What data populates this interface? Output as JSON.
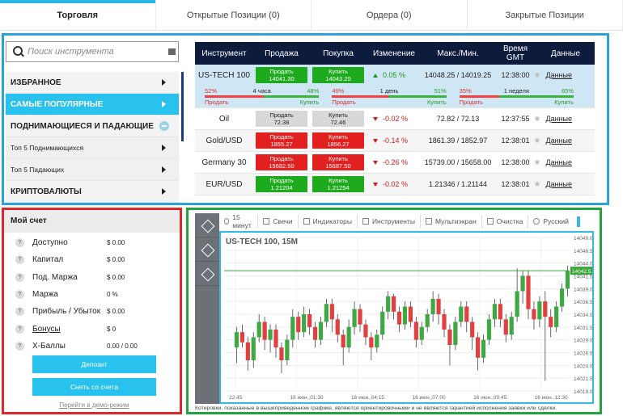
{
  "tabs": [
    {
      "label": "Торговля",
      "active": true
    },
    {
      "label": "Открытые Позиции (0)",
      "active": false
    },
    {
      "label": "Ордера (0)",
      "active": false
    },
    {
      "label": "Закрытые Позиции",
      "active": false
    }
  ],
  "search": {
    "placeholder": "Поиск инструмента"
  },
  "categories": [
    {
      "label": "ИЗБРАННОЕ"
    },
    {
      "label": "САМЫЕ ПОПУЛЯРНЫЕ"
    },
    {
      "label": "ПОДНИМАЮЩИЕСЯ И ПАДАЮЩИЕ"
    },
    {
      "label": "Топ 5 Поднимающихся"
    },
    {
      "label": "Топ 5 Падающих"
    },
    {
      "label": "КРИПТОВАЛЮТЫ"
    }
  ],
  "table": {
    "headers": {
      "instrument": "Инструмент",
      "sell": "Продажа",
      "buy": "Покупка",
      "change": "Изменение",
      "maxmin": "Макс./Мин.",
      "time": "Время GMT",
      "data": "Данные"
    },
    "sell_word": "Продать",
    "buy_word": "Купить",
    "data_link": "Данные",
    "rows": [
      {
        "name": "US-TECH 100",
        "sell": "14041.30",
        "buy": "14043.20",
        "change": "0.05 %",
        "maxmin": "14048.25 / 14019.25",
        "time": "12:38:00"
      },
      {
        "name": "Oil",
        "sell": "72.38",
        "buy": "72.46",
        "change": "-0.02 %",
        "maxmin": "72.82 / 72.13",
        "time": "12:37:55"
      },
      {
        "name": "Gold/USD",
        "sell": "1855.27",
        "buy": "1856.27",
        "change": "-0.14 %",
        "maxmin": "1861.39 / 1852.97",
        "time": "12:38:01"
      },
      {
        "name": "Germany 30",
        "sell": "15682.50",
        "buy": "15687.50",
        "change": "-0.26 %",
        "maxmin": "15739.00 / 15658.00",
        "time": "12:38:00"
      },
      {
        "name": "EUR/USD",
        "sell": "1.21204",
        "buy": "1.21254",
        "change": "-0.02 %",
        "maxmin": "1.21346 / 1.21144",
        "time": "12:38:01"
      }
    ],
    "sentiment": [
      {
        "left_pct": "52%",
        "period": "4 часа",
        "right_pct": "48%",
        "value": 0.52
      },
      {
        "left_pct": "49%",
        "period": "1 день",
        "right_pct": "51%",
        "value": 0.49
      },
      {
        "left_pct": "35%",
        "period": "1 неделя",
        "right_pct": "65%",
        "value": 0.35
      }
    ]
  },
  "account": {
    "title": "Мой счет",
    "rows": [
      {
        "label": "Доступно",
        "value": "$ 0.00"
      },
      {
        "label": "Капитал",
        "value": "$ 0.00"
      },
      {
        "label": "Под. Маржа",
        "value": "$ 0.00"
      },
      {
        "label": "Маржа",
        "value": "0 %"
      },
      {
        "label": "Прибыль / Убыток",
        "value": "$ 0.00"
      },
      {
        "label": "Бонусы",
        "value": "$ 0"
      },
      {
        "label": "Х-Баллы",
        "value": "0.00 / 0.00"
      }
    ],
    "deposit_label": "Депозит",
    "withdraw_label": "Снять со счета",
    "demo_label": "Перейти в демо-режим"
  },
  "chart_toolbar": [
    "15 минут",
    "Свечи",
    "Индикаторы",
    "Инструменты",
    "Мультиэкран",
    "Очистка",
    "Русский"
  ],
  "chart_data": {
    "type": "candlestick",
    "title": "US-TECH 100, 15M",
    "current_price": "14042.5",
    "y_ticks": [
      "14049.0",
      "14046.5",
      "14044.0",
      "14041.5",
      "14039.0",
      "14036.5",
      "14034.0",
      "14031.5",
      "14029.0",
      "14026.5",
      "14024.0",
      "14021.5",
      "14019.0"
    ],
    "x_ticks": [
      "22:45",
      "16 июн.,01:30",
      "16 июн.,04:15",
      "16 июн.,07:00",
      "16 июн.,09:45",
      "16 июн.,12:30"
    ],
    "ylim": [
      14019,
      14049
    ],
    "candles": [
      [
        14027.5,
        14030.5,
        14024.5,
        14031.5
      ],
      [
        14030.5,
        14028.5,
        14027.5,
        14032.0
      ],
      [
        14028.5,
        14025.0,
        14023.0,
        14029.5
      ],
      [
        14025.0,
        14029.5,
        14023.5,
        14030.5
      ],
      [
        14029.5,
        14032.5,
        14028.5,
        14034.0
      ],
      [
        14032.5,
        14029.0,
        14027.0,
        14033.5
      ],
      [
        14029.0,
        14031.0,
        14026.5,
        14032.0
      ],
      [
        14031.0,
        14027.5,
        14025.5,
        14032.0
      ],
      [
        14027.5,
        14025.0,
        14022.5,
        14028.5
      ],
      [
        14025.0,
        14029.0,
        14024.0,
        14030.0
      ],
      [
        14029.0,
        14033.5,
        14027.5,
        14035.0
      ],
      [
        14033.5,
        14030.5,
        14029.0,
        14034.5
      ],
      [
        14030.5,
        14034.0,
        14029.5,
        14035.5
      ],
      [
        14034.0,
        14031.5,
        14030.0,
        14035.0
      ],
      [
        14031.5,
        14029.0,
        14027.5,
        14032.5
      ],
      [
        14029.0,
        14032.5,
        14028.0,
        14033.5
      ],
      [
        14032.5,
        14036.0,
        14031.5,
        14037.0
      ],
      [
        14036.0,
        14033.0,
        14030.5,
        14037.0
      ],
      [
        14033.0,
        14030.0,
        14028.5,
        14034.0
      ],
      [
        14030.0,
        14027.5,
        14024.0,
        14031.0
      ],
      [
        14027.5,
        14031.5,
        14026.5,
        14033.0
      ],
      [
        14031.5,
        14035.0,
        14030.0,
        14036.5
      ],
      [
        14035.0,
        14032.0,
        14030.5,
        14036.0
      ],
      [
        14032.0,
        14029.5,
        14028.0,
        14033.0
      ],
      [
        14029.5,
        14027.5,
        14025.0,
        14030.5
      ],
      [
        14027.5,
        14030.0,
        14026.5,
        14031.0
      ],
      [
        14030.0,
        14034.5,
        14029.0,
        14035.5
      ],
      [
        14034.5,
        14037.5,
        14033.0,
        14038.5
      ],
      [
        14037.5,
        14034.5,
        14033.0,
        14038.0
      ],
      [
        14034.5,
        14032.0,
        14030.5,
        14035.5
      ],
      [
        14032.0,
        14035.5,
        14031.0,
        14036.5
      ],
      [
        14035.5,
        14032.5,
        14031.5,
        14036.5
      ],
      [
        14032.5,
        14029.0,
        14027.5,
        14033.5
      ],
      [
        14029.0,
        14031.5,
        14028.0,
        14032.5
      ],
      [
        14031.5,
        14034.0,
        14030.5,
        14035.0
      ],
      [
        14034.0,
        14037.0,
        14032.5,
        14038.5
      ],
      [
        14037.0,
        14034.0,
        14032.0,
        14038.0
      ],
      [
        14034.0,
        14031.0,
        14029.5,
        14035.0
      ],
      [
        14031.0,
        14028.0,
        14024.0,
        14032.0
      ],
      [
        14028.0,
        14032.5,
        14027.0,
        14033.5
      ],
      [
        14032.5,
        14035.5,
        14031.5,
        14036.5
      ],
      [
        14035.5,
        14032.5,
        14030.5,
        14036.5
      ],
      [
        14032.5,
        14029.5,
        14027.0,
        14033.5
      ],
      [
        14029.5,
        14025.5,
        14023.0,
        14030.5
      ],
      [
        14025.5,
        14029.0,
        14024.5,
        14030.0
      ],
      [
        14029.0,
        14033.0,
        14028.0,
        14034.0
      ],
      [
        14033.0,
        14036.0,
        14031.5,
        14037.0
      ],
      [
        14036.0,
        14033.0,
        14031.5,
        14037.0
      ],
      [
        14033.0,
        14030.0,
        14028.5,
        14034.0
      ],
      [
        14030.0,
        14033.5,
        14029.0,
        14034.5
      ],
      [
        14033.5,
        14038.5,
        14032.5,
        14043.0
      ],
      [
        14038.5,
        14041.5,
        14036.0,
        14042.5
      ],
      [
        14041.5,
        14035.0,
        14033.0,
        14042.5
      ],
      [
        14035.0,
        14033.0,
        14031.0,
        14036.5
      ],
      [
        14033.0,
        14036.5,
        14031.5,
        14037.5
      ],
      [
        14036.5,
        14033.5,
        14021.0,
        14038.5
      ],
      [
        14033.5,
        14031.5,
        14029.5,
        14035.0
      ],
      [
        14031.5,
        14035.5,
        14030.5,
        14036.5
      ],
      [
        14035.5,
        14039.0,
        14034.5,
        14040.0
      ],
      [
        14039.0,
        14042.5,
        14037.5,
        14043.5
      ]
    ]
  },
  "disclaimer": "Котировки, показанные в вышеприведенном графике, являются ориентировочными и не являются гарантией исполнения заявки или сделки."
}
